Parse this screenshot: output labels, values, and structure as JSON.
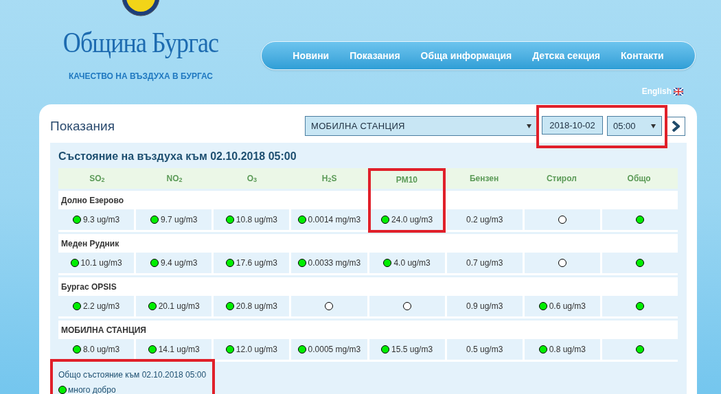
{
  "header": {
    "site_title": "Община Бургас",
    "subtitle": "КАЧЕСТВО НА ВЪЗДУХА В БУРГАС"
  },
  "nav": [
    {
      "label": "Новини"
    },
    {
      "label": "Показания"
    },
    {
      "label": "Обща информация"
    },
    {
      "label": "Детска секция"
    },
    {
      "label": "Контакти"
    }
  ],
  "language": {
    "label": "English"
  },
  "panel": {
    "title": "Показания",
    "station_select": "МОБИЛНА СТАНЦИЯ",
    "date": "2018-10-02",
    "time": "05:00",
    "date_time_highlighted": true
  },
  "table": {
    "heading": "Състояние на въздуха към 02.10.2018 05:00",
    "columns": [
      {
        "label": "SO$_{2}$",
        "highlighted": false
      },
      {
        "label": "NO$_{2}$",
        "highlighted": false
      },
      {
        "label": "O$_{3}$",
        "highlighted": false
      },
      {
        "label": "H$_{2}$S",
        "highlighted": false
      },
      {
        "label": "PM10",
        "highlighted": true
      },
      {
        "label": "Бензен",
        "highlighted": false
      },
      {
        "label": "Стирол",
        "highlighted": false
      },
      {
        "label": "Общо",
        "highlighted": false
      }
    ],
    "rows": [
      {
        "station": "Долно Езерово",
        "cells": [
          {
            "color": "#00ee00",
            "value": "9.3 ug/m3"
          },
          {
            "color": "#00ee00",
            "value": "9.7 ug/m3"
          },
          {
            "color": "#00ee00",
            "value": "10.8 ug/m3"
          },
          {
            "color": "#00ee00",
            "value": "0.0014 mg/m3"
          },
          {
            "color": "#00ee00",
            "value": "24.0 ug/m3"
          },
          {
            "value": "0.2 ug/m3"
          },
          {
            "color": "#ffffff"
          },
          {
            "color": "#00ee00"
          }
        ]
      },
      {
        "station": "Меден Рудник",
        "cells": [
          {
            "color": "#00ee00",
            "value": "10.1 ug/m3"
          },
          {
            "color": "#00ee00",
            "value": "9.4 ug/m3"
          },
          {
            "color": "#00ee00",
            "value": "17.6 ug/m3"
          },
          {
            "color": "#00ee00",
            "value": "0.0033 mg/m3"
          },
          {
            "color": "#00ee00",
            "value": "4.0 ug/m3"
          },
          {
            "value": "0.7 ug/m3"
          },
          {
            "color": "#ffffff"
          },
          {
            "color": "#00ee00"
          }
        ]
      },
      {
        "station": "Бургас OPSIS",
        "cells": [
          {
            "color": "#00ee00",
            "value": "2.2 ug/m3"
          },
          {
            "color": "#00ee00",
            "value": "20.1 ug/m3"
          },
          {
            "color": "#00ee00",
            "value": "20.8 ug/m3"
          },
          {
            "color": "#ffffff"
          },
          {
            "color": "#ffffff"
          },
          {
            "value": "0.9 ug/m3"
          },
          {
            "color": "#00ee00",
            "value": "0.6 ug/m3"
          },
          {
            "color": "#00ee00"
          }
        ]
      },
      {
        "station": "МОБИЛНА СТАНЦИЯ",
        "cells": [
          {
            "color": "#00ee00",
            "value": "8.0 ug/m3"
          },
          {
            "color": "#00ee00",
            "value": "14.1 ug/m3"
          },
          {
            "color": "#00ee00",
            "value": "12.0 ug/m3"
          },
          {
            "color": "#00ee00",
            "value": "0.0005 mg/m3"
          },
          {
            "color": "#00ee00",
            "value": "15.5 ug/m3"
          },
          {
            "value": "0.5 ug/m3"
          },
          {
            "color": "#00ee00",
            "value": "0.8 ug/m3"
          },
          {
            "color": "#00ee00"
          }
        ]
      }
    ]
  },
  "summary": {
    "text": "Общо състояние към 02.10.2018 05:00",
    "color": "#00ee00",
    "rating": "много добро",
    "highlighted": true
  }
}
